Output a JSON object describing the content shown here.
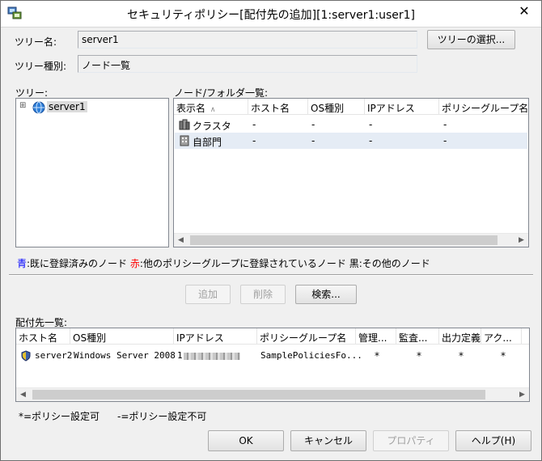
{
  "title": "セキュリティポリシー[配付先の追加][1:server1:user1]",
  "close_glyph": "✕",
  "tree_name": {
    "label": "ツリー名:",
    "value": "server1",
    "select_button": "ツリーの選択..."
  },
  "tree_type": {
    "label": "ツリー種別:",
    "value": "ノード一覧"
  },
  "tree_panel": {
    "label": "ツリー:",
    "expand_glyph": "⊞",
    "root_node": "server1"
  },
  "node_panel": {
    "label": "ノード/フォルダ一覧:",
    "columns": [
      "表示名",
      "ホスト名",
      "OS種別",
      "IPアドレス",
      "ポリシーグループ名"
    ],
    "sort_glyph": "∧",
    "rows": [
      {
        "name": "クラスタ",
        "host": "-",
        "os": "-",
        "ip": "-",
        "group": "-",
        "icon": "cluster-icon"
      },
      {
        "name": "自部門",
        "host": "-",
        "os": "-",
        "ip": "-",
        "group": "-",
        "icon": "department-icon"
      }
    ]
  },
  "legend": {
    "blue_key": "青",
    "blue_text": ":既に登録済みのノード",
    "red_key": "赤",
    "red_text": ":他のポリシーグループに登録されているノード",
    "black_key": "黒",
    "black_text": ":その他のノード",
    "colors": {
      "blue": "#0000ff",
      "red": "#ff0000",
      "black": "#000000"
    }
  },
  "actions": {
    "add": "追加",
    "delete": "削除",
    "search": "検索..."
  },
  "target_panel": {
    "label": "配付先一覧:",
    "columns": [
      "ホスト名",
      "OS種別",
      "IPアドレス",
      "ポリシーグループ名",
      "管理...",
      "監査...",
      "出力定義",
      "アク..."
    ],
    "rows": [
      {
        "host": "server2",
        "os": "Windows Server 2008",
        "ip": "1",
        "group": "SamplePoliciesFo...",
        "c1": "*",
        "c2": "*",
        "c3": "*",
        "c4": "*"
      }
    ]
  },
  "notes": {
    "settable": "*=ポリシー設定可",
    "not_settable": "-=ポリシー設定不可"
  },
  "footer": {
    "ok": "OK",
    "cancel": "キャンセル",
    "properties": "プロパティ",
    "help": "ヘルプ(H)"
  }
}
